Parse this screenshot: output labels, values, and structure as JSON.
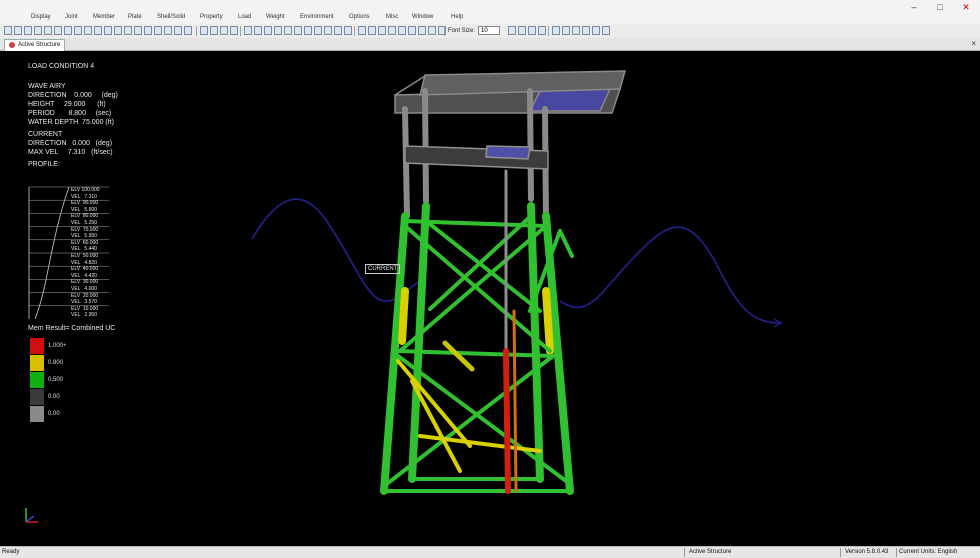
{
  "menu": [
    "Display",
    "Joint",
    "Member",
    "Plate",
    "Shell/Solid",
    "Property",
    "Load",
    "Weight",
    "Environment",
    "Options",
    "Misc",
    "Window",
    "Help"
  ],
  "window_controls": {
    "minimize": "–",
    "maximize": "□",
    "close": "✕"
  },
  "toolbar": {
    "font_size_label": "Font Size:",
    "font_size_value": "10"
  },
  "tab": {
    "label": "Active Structure",
    "close": "×"
  },
  "load": {
    "title": "LOAD CONDITION 4",
    "wave_header": "WAVE AIRY",
    "wave_lines": [
      "DIRECTION    0.000     (deg)",
      "HEIGHT     29.000      (ft)",
      "PERIOD       8.800     (sec)",
      "WATER DEPTH  75.000 (ft)"
    ],
    "current_header": "CURRENT",
    "current_lines": [
      "DIRECTION   0.000   (deg)",
      "MAX VEL     7.310   (ft/sec)"
    ],
    "profile_header": "PROFILE:",
    "profile_lines": [
      "ELV 100.000",
      "VEL   7.310",
      "ELV  90.000",
      "VEL   5.600",
      "ELV  80.000",
      "VEL   5.250",
      "ELV  70.000",
      "VEL   5.950",
      "ELV  60.000",
      "VEL   5.440",
      "ELV  50.000",
      "VEL   4.820",
      "ELV  40.000",
      "VEL   4.420",
      "ELV  30.000",
      "VEL   4.000",
      "ELV  20.000",
      "VEL   3.570",
      "ELV  10.000",
      "VEL   2.950"
    ]
  },
  "legend": {
    "title": "Mem Result= Combined UC",
    "items": [
      {
        "label": "1.000+",
        "color": "#d01010"
      },
      {
        "label": "0.800",
        "color": "#d8c000"
      },
      {
        "label": "0.500",
        "color": "#10b010"
      },
      {
        "label": "0.00",
        "color": "#3a3a3a"
      },
      {
        "label": "0.00",
        "color": "#8a8a8a"
      }
    ]
  },
  "current_tag": "CURRENT",
  "status": {
    "left": "Ready",
    "center": "Active Structure",
    "version": "Version 5.8.0.43",
    "units": "Current Units: English"
  },
  "colors": {
    "member_green": "#30c030",
    "member_yellow": "#d8d000",
    "member_red": "#d02010",
    "member_gray": "#909090",
    "deck_plate": "#4848a0",
    "wave": "#202080"
  }
}
